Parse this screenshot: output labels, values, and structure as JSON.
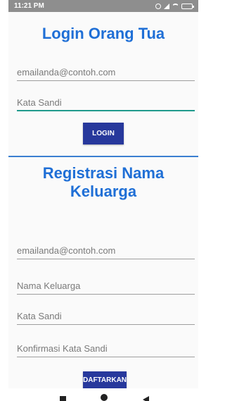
{
  "status_bar": {
    "time": "11:21 PM"
  },
  "login": {
    "title": "Login Orang Tua",
    "email_placeholder": "emailanda@contoh.com",
    "password_placeholder": "Kata Sandi",
    "button_label": "LOGIN"
  },
  "register": {
    "title": "Registrasi Nama Keluarga",
    "email_placeholder": "emailanda@contoh.com",
    "family_name_placeholder": "Nama Keluarga",
    "password_placeholder": "Kata Sandi",
    "confirm_password_placeholder": "Konfirmasi Kata Sandi",
    "button_label": "DAFTARKAN"
  },
  "colors": {
    "title": "#1f6fd6",
    "button": "#27389c",
    "divider": "#3a7fd1",
    "active_underline": "#1f9a8c"
  },
  "nav_bar": {
    "icons": [
      "square-icon",
      "circle-icon",
      "back-icon"
    ]
  }
}
